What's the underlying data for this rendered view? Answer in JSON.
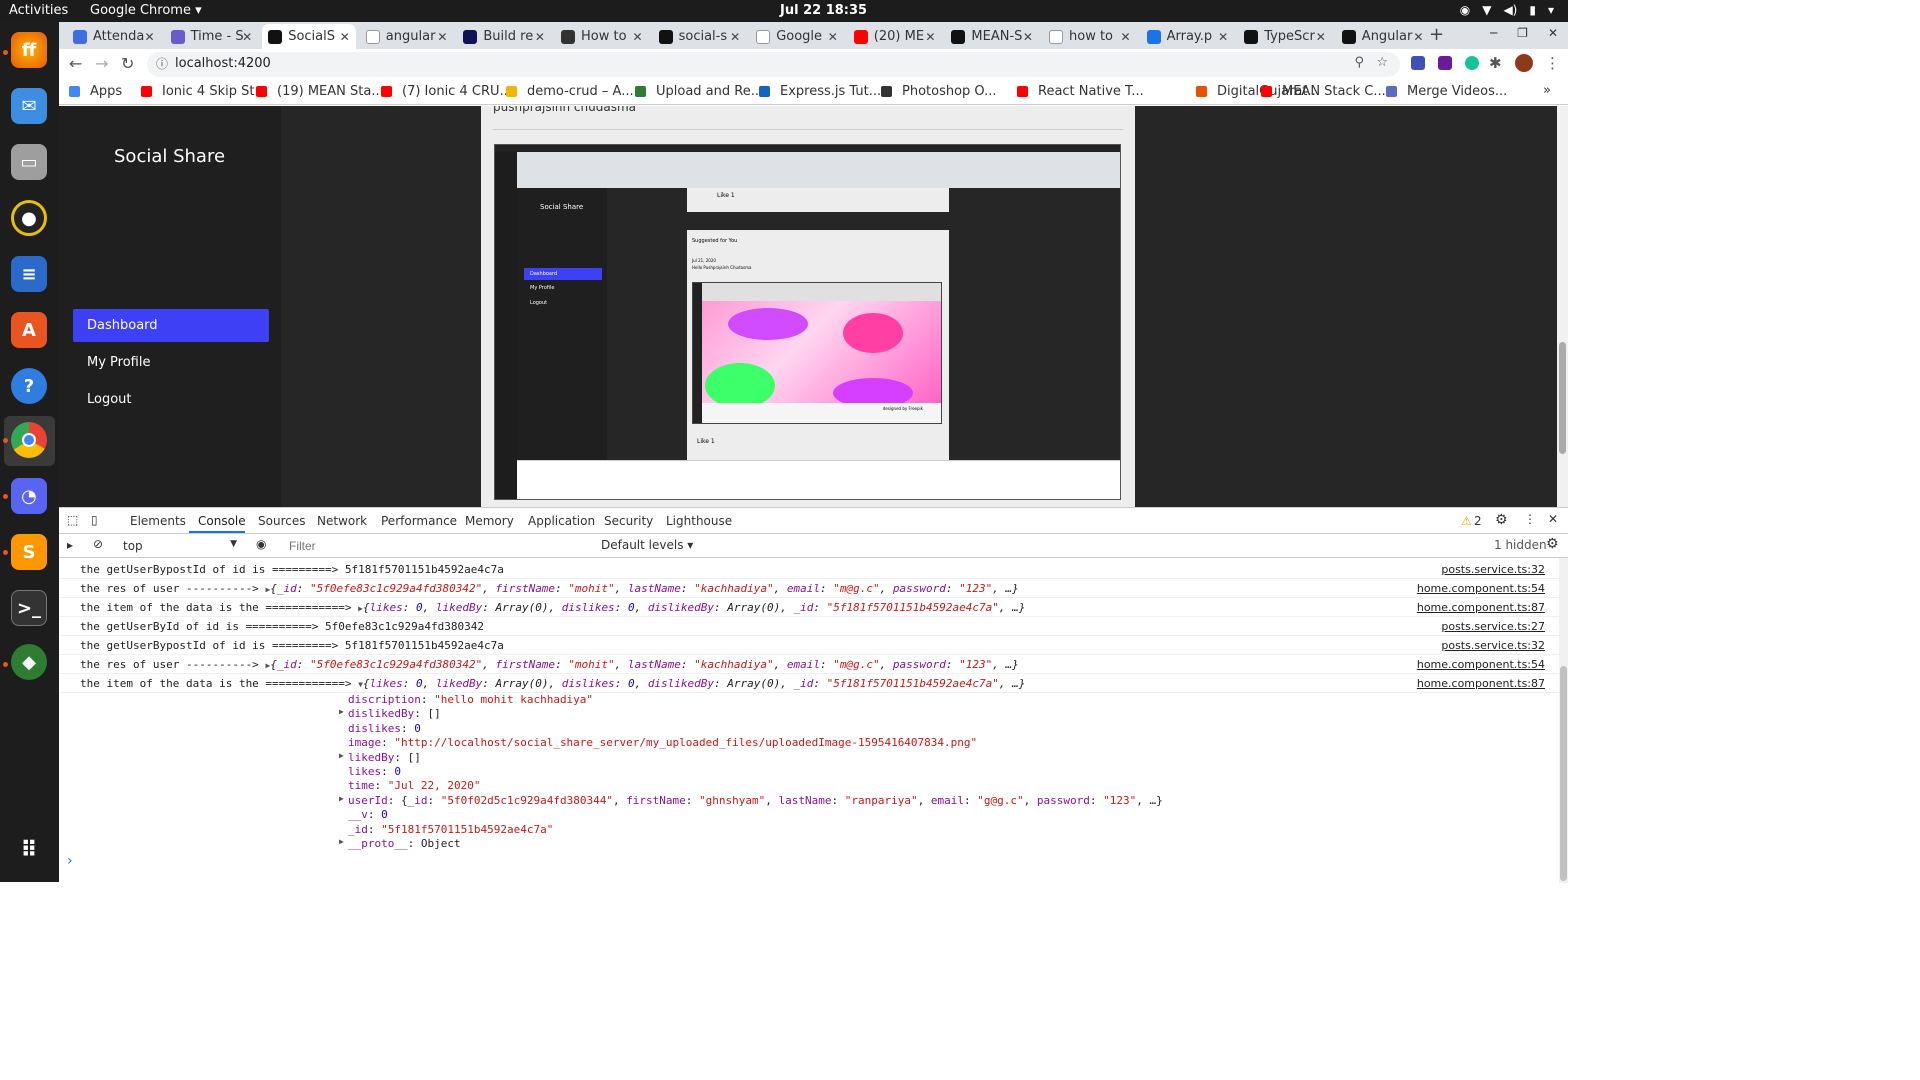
{
  "os": {
    "activities": "Activities",
    "app": "Google Chrome ▾",
    "clock": "Jul 22  18:35"
  },
  "browser": {
    "tabs": [
      "Attenda",
      "Time - S",
      "SocialS",
      "angular",
      "Build re",
      "How to",
      "social-s",
      "Google",
      "(20) ME",
      "MEAN-S",
      "how to",
      "Array.p",
      "TypeScr",
      "Angular"
    ],
    "tab_colors": [
      "#3c6ee6",
      "#6a5acd",
      "#111111",
      "#ffffff",
      "#111155",
      "#333333",
      "#111111",
      "#ffffff",
      "#ff0000",
      "#111111",
      "#ffffff",
      "#1a73e8",
      "#111111",
      "#111111"
    ],
    "url": "localhost:4200",
    "bookmarks": [
      "Apps",
      "Ionic 4 Skip St...",
      "(19) MEAN Sta...",
      "(7) Ionic 4 CRU...",
      "demo-crud – A...",
      "Upload and Re...",
      "Express.js Tut...",
      "Photoshop O...",
      "React Native T...",
      "DigitalGujarat...",
      "MEAN Stack C...",
      "Merge Videos..."
    ],
    "bookmark_colors": [
      "#4285f4",
      "#ff0000",
      "#ff0000",
      "#ff0000",
      "#f4b400",
      "#2e7d32",
      "#1565c0",
      "#333333",
      "#ff0000",
      "#e65100",
      "#ff0000",
      "#5c6bc0"
    ]
  },
  "app": {
    "brand": "Social Share",
    "nav": [
      "Dashboard",
      "My Profile",
      "Logout"
    ],
    "author": "pushprajsinh chudasma"
  },
  "nested": {
    "brand": "Social Share",
    "nav": [
      "Dashboard",
      "My Profile",
      "Logout"
    ],
    "like": "Like",
    "like_count": "1",
    "suggest": "Suggested for You",
    "date": "Jul 21, 2020",
    "hello": "Hello Pushprajsinh Chudasma",
    "designed": "designed by Freepik"
  },
  "devtools": {
    "tabs": [
      "Elements",
      "Console",
      "Sources",
      "Network",
      "Performance",
      "Memory",
      "Application",
      "Security",
      "Lighthouse"
    ],
    "warn": "2",
    "context": "top",
    "filter_ph": "Filter",
    "levels": "Default levels ▾",
    "hidden": "1 hidden",
    "logs": [
      {
        "text": "the getUserBypostId of id is =========> 5f181f5701151b4592ae4c7a",
        "src": "posts.service.ts:32"
      },
      {
        "text": "the res of user ----------> ▶{_id: \"5f0efe83c1c929a4fd380342\", firstName: \"mohit\", lastName: \"kachhadiya\", email: \"m@g.c\", password: \"123\", …}",
        "src": "home.component.ts:54"
      },
      {
        "text": "the item of the data is the ============> ▶{likes: 0, likedBy: Array(0), dislikes: 0, dislikedBy: Array(0), _id: \"5f181f5701151b4592ae4c7a\", …}",
        "src": "home.component.ts:87"
      },
      {
        "text": "the getUserById of id is ==========> 5f0efe83c1c929a4fd380342",
        "src": "posts.service.ts:27"
      },
      {
        "text": "the getUserBypostId of id is =========> 5f181f5701151b4592ae4c7a",
        "src": "posts.service.ts:32"
      },
      {
        "text": "the res of user ----------> ▶{_id: \"5f0efe83c1c929a4fd380342\", firstName: \"mohit\", lastName: \"kachhadiya\", email: \"m@g.c\", password: \"123\", …}",
        "src": "home.component.ts:54"
      },
      {
        "text": "the item of the data is the ============> ▼{likes: 0, likedBy: Array(0), dislikes: 0, dislikedBy: Array(0), _id: \"5f181f5701151b4592ae4c7a\", …}",
        "src": "home.component.ts:87"
      }
    ],
    "expanded": [
      {
        "k": "discription",
        "v": "\"hello mohit kachhadiya\"",
        "arrow": false
      },
      {
        "k": "dislikedBy",
        "v": "[]",
        "arrow": true
      },
      {
        "k": "dislikes",
        "v": "0",
        "arrow": false
      },
      {
        "k": "image",
        "v": "\"http://localhost/social_share_server/my_uploaded_files/uploadedImage-1595416407834.png\"",
        "arrow": false
      },
      {
        "k": "likedBy",
        "v": "[]",
        "arrow": true
      },
      {
        "k": "likes",
        "v": "0",
        "arrow": false
      },
      {
        "k": "time",
        "v": "\"Jul 22, 2020\"",
        "arrow": false
      },
      {
        "k": "userId",
        "v": "{_id: \"5f0f02d5c1c929a4fd380344\", firstName: \"ghnshyam\", lastName: \"ranpariya\", email: \"g@g.c\", password: \"123\", …}",
        "arrow": true
      },
      {
        "k": "__v",
        "v": "0",
        "arrow": false
      },
      {
        "k": "_id",
        "v": "\"5f181f5701151b4592ae4c7a\"",
        "arrow": false
      },
      {
        "k": "__proto__",
        "v": "Object",
        "arrow": true
      }
    ],
    "prompt": "›"
  }
}
